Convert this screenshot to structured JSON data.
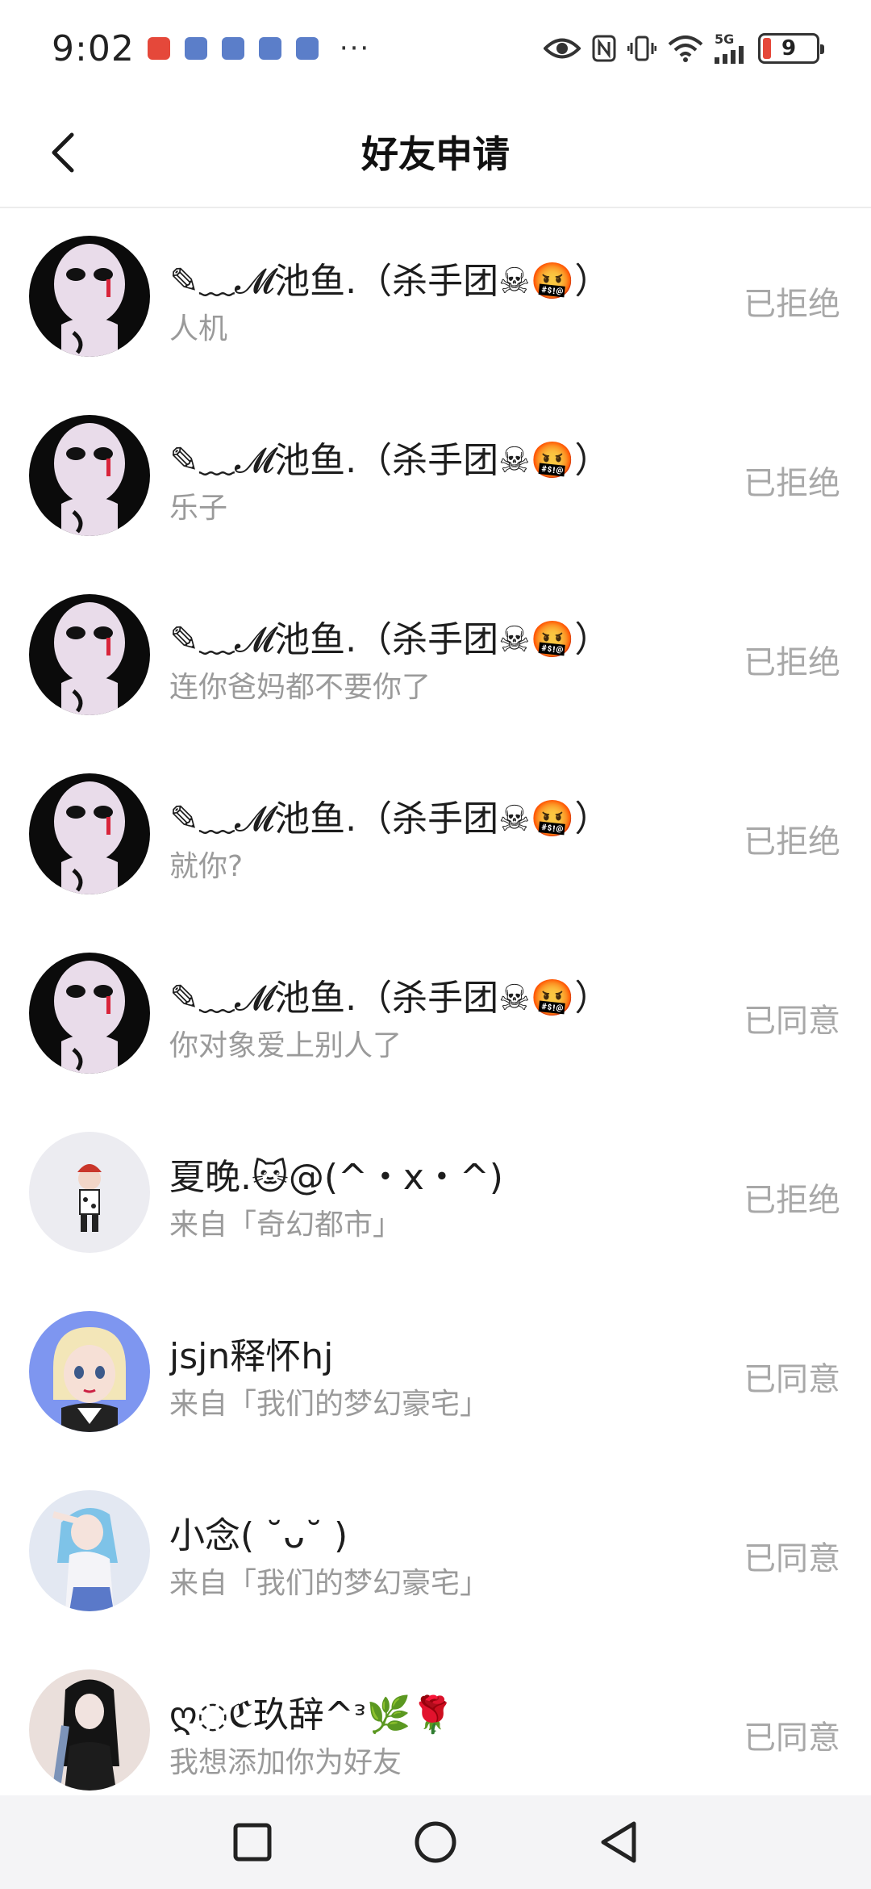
{
  "status_bar": {
    "time": "9:02",
    "more_indicator": "···",
    "network_label": "5G",
    "battery_level": "9",
    "notification_icons": [
      "app-notification-icon",
      "calendar-icon",
      "robot-icon",
      "robot-icon",
      "robot-icon"
    ]
  },
  "header": {
    "title": "好友申请"
  },
  "requests": [
    {
      "name": "✎﹏𝓜池鱼.（杀手团☠🤬）",
      "message": "人机",
      "status": "已拒绝",
      "avatar": "dark-anime-avatar"
    },
    {
      "name": "✎﹏𝓜池鱼.（杀手团☠🤬）",
      "message": "乐子",
      "status": "已拒绝",
      "avatar": "dark-anime-avatar"
    },
    {
      "name": "✎﹏𝓜池鱼.（杀手团☠🤬）",
      "message": "连你爸妈都不要你了",
      "status": "已拒绝",
      "avatar": "dark-anime-avatar"
    },
    {
      "name": "✎﹏𝓜池鱼.（杀手团☠🤬）",
      "message": "就你?",
      "status": "已拒绝",
      "avatar": "dark-anime-avatar"
    },
    {
      "name": "✎﹏𝓜池鱼.（杀手团☠🤬）",
      "message": "你对象爱上别人了",
      "status": "已同意",
      "avatar": "dark-anime-avatar"
    },
    {
      "name": "夏晚.🐱@(^・x・^)",
      "message": "来自「奇幻都市」",
      "status": "已拒绝",
      "avatar": "chibi-character-avatar"
    },
    {
      "name": "jsjn释怀hj",
      "message": "来自「我们的梦幻豪宅」",
      "status": "已同意",
      "avatar": "blonde-anime-avatar"
    },
    {
      "name": "小念( ˘ᴗ˘ )",
      "message": "来自「我们的梦幻豪宅」",
      "status": "已同意",
      "avatar": "blue-hair-anime-avatar"
    },
    {
      "name": "ღ◌ℭ玖辞^ᵌ🌿🌹",
      "message": "我想添加你为好友",
      "status": "已同意",
      "avatar": "dark-hair-girl-avatar"
    }
  ],
  "bottom_nav": {
    "buttons": [
      "recents-square-icon",
      "home-circle-icon",
      "back-triangle-icon"
    ]
  },
  "colors": {
    "status_text": "#a8a8a8",
    "message_text": "#9a9a9a",
    "battery_low": "#e5483a",
    "nav_bar_bg": "#f4f4f6"
  }
}
